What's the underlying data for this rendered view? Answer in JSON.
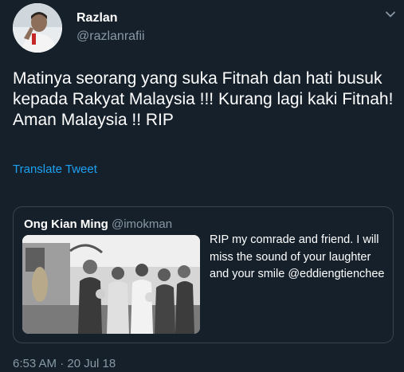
{
  "tweet": {
    "author": {
      "name": "Razlan",
      "handle": "@razlanrafii",
      "avatar_icon": "profile-photo"
    },
    "text": "Matinya seorang yang suka Fitnah dan hati busuk kepada Rakyat Malaysia !!! Kurang lagi kaki Fitnah! Aman Malaysia !! RIP",
    "translate_label": "Translate Tweet",
    "timestamp": "6:53 AM · 20 Jul 18"
  },
  "quoted_tweet": {
    "author": {
      "name": "Ong Kian Ming",
      "handle": "@imokman"
    },
    "text": "RIP my comrade and friend. I will miss the sound of your laughter and your smile @eddiengtienchee",
    "photo_icon": "group-photo"
  },
  "menu": {
    "icon": "chevron-down-icon"
  },
  "colors": {
    "background": "#15202b",
    "text_primary": "#ffffff",
    "text_secondary": "#8899a6",
    "link": "#1da1f2",
    "border": "#38444d"
  }
}
